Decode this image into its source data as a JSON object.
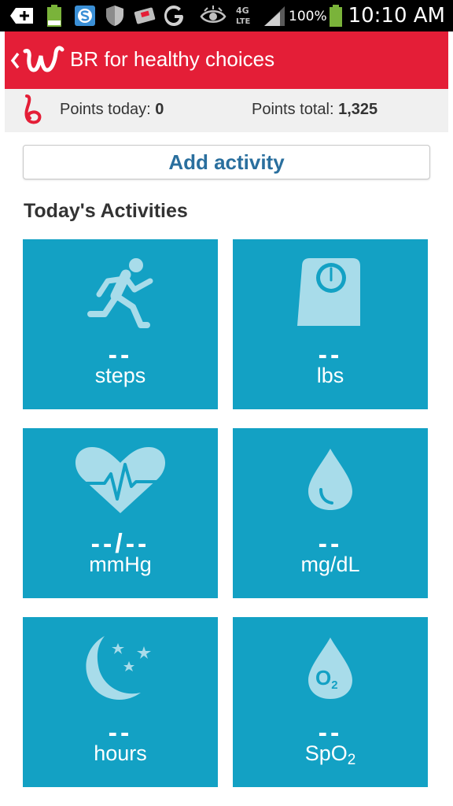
{
  "status_bar": {
    "battery_percent": "100%",
    "time": "10:10 AM",
    "network": "4G LTE",
    "icons": [
      "add-icon",
      "battery-level-icon",
      "skype-icon",
      "shield-icon",
      "card-icon",
      "google-icon",
      "eye-icon",
      "signal-icon",
      "battery-icon"
    ]
  },
  "app_bar": {
    "title": "BR for healthy choices",
    "color": "#e41e37"
  },
  "points": {
    "today_label": "Points today:",
    "today_value": "0",
    "total_label": "Points total:",
    "total_value": "1,325"
  },
  "add_activity": {
    "label": "Add activity"
  },
  "activities": {
    "title": "Today's Activities",
    "tile_color": "#13a1c4",
    "tiles": [
      {
        "icon": "running-person-icon",
        "value": "--",
        "unit": "steps"
      },
      {
        "icon": "scale-icon",
        "value": "--",
        "unit": "lbs"
      },
      {
        "icon": "heart-pulse-icon",
        "value": "--/--",
        "unit": "mmHg"
      },
      {
        "icon": "drop-icon",
        "value": "--",
        "unit": "mg/dL"
      },
      {
        "icon": "moon-stars-icon",
        "value": "--",
        "unit": "hours"
      },
      {
        "icon": "oxygen-drop-icon",
        "value": "--",
        "unit_base": "SpO",
        "unit_sub": "2",
        "icon_label_base": "O",
        "icon_label_sub": "2"
      }
    ]
  }
}
